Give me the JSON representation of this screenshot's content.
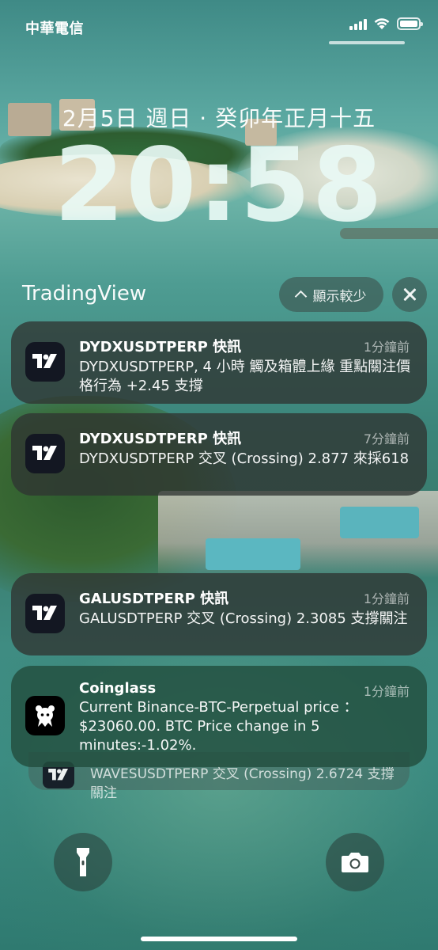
{
  "status_bar": {
    "carrier": "中華電信",
    "signal_bars": 4,
    "wifi": "wifi-icon",
    "battery": "battery-icon",
    "battery_level": 1.0
  },
  "lock_screen": {
    "date": "2月5日 週日 · 癸卯年正月十五",
    "time": "20:58"
  },
  "group": {
    "app_name": "TradingView",
    "show_less_label": "顯示較少",
    "close_icon": "close-icon"
  },
  "notifications": [
    {
      "app_icon": "tradingview-icon",
      "title": "DYDXUSDTPERP 快訊",
      "time": "1分鐘前",
      "body": "DYDXUSDTPERP, 4 小時 觸及箱體上緣 重點關注價格行為 +2.45 支撐"
    },
    {
      "app_icon": "tradingview-icon",
      "title": "DYDXUSDTPERP 快訊",
      "time": "7分鐘前",
      "body": "DYDXUSDTPERP 交叉 (Crossing) 2.877 來採618"
    },
    {
      "app_icon": "tradingview-icon",
      "title": "GALUSDTPERP 快訊",
      "time": "1分鐘前",
      "body": "GALUSDTPERP 交叉 (Crossing) 2.3085 支撐關注"
    },
    {
      "app_icon": "coinglass-icon",
      "title": "Coinglass",
      "time": "1分鐘前",
      "body": "Current Binance-BTC-Perpetual price ：$23060.00. BTC Price change in 5 minutes:-1.02%."
    }
  ],
  "stacked_notification": {
    "app_icon": "tradingview-icon",
    "body": "WAVESUSDTPERP 交叉 (Crossing) 2.6724 支撐 關注"
  },
  "controls": {
    "flashlight": "flashlight-icon",
    "camera": "camera-icon"
  }
}
